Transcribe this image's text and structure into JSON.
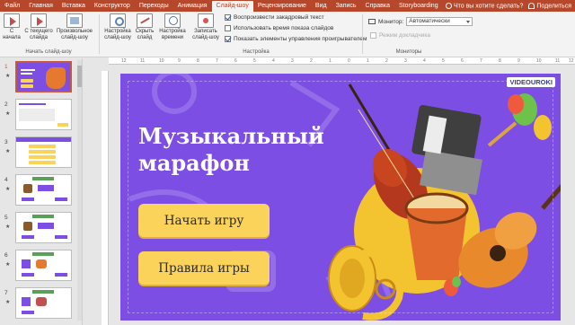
{
  "tabs": [
    "Файл",
    "Главная",
    "Вставка",
    "Конструктор",
    "Переходы",
    "Анимация",
    "Слайд-шоу",
    "Рецензирование",
    "Вид",
    "Запись",
    "Справка",
    "Storyboarding"
  ],
  "tell_me": "Что вы хотите сделать?",
  "share": "Поделиться",
  "ribbon": {
    "btn_start": "С\nначала",
    "btn_current": "С текущего\nслайда",
    "btn_custom": "Произвольное\nслайд-шоу",
    "group_start": "Начать слайд-шоу",
    "btn_setup": "Настройка\nслайд-шоу",
    "btn_hide": "Скрыть\nслайд",
    "btn_timing": "Настройка\nвремени",
    "btn_record": "Записать\nслайд-шоу",
    "chk_narration": "Воспроизвести закадровый текст",
    "chk_timings": "Использовать время показа слайдов",
    "chk_controls": "Показать элементы управления проигрывателем",
    "group_setup": "Настройка",
    "monitor_label": "Монитор:",
    "monitor_value": "Автоматически",
    "presenter_view": "Режим докладчика",
    "group_monitors": "Мониторы"
  },
  "thumbnails": [
    "1",
    "2",
    "3",
    "4",
    "5",
    "6",
    "7"
  ],
  "ruler_ticks": [
    "12",
    "11",
    "10",
    "9",
    "8",
    "7",
    "6",
    "5",
    "4",
    "3",
    "2",
    "1",
    "0",
    "1",
    "2",
    "3",
    "4",
    "5",
    "6",
    "7",
    "8",
    "9",
    "10",
    "11",
    "12"
  ],
  "slide": {
    "logo": "VIDEOUROKI",
    "title": "Музыкальный\nмарафон",
    "start_button": "Начать игру",
    "rules_button": "Правила игры"
  }
}
